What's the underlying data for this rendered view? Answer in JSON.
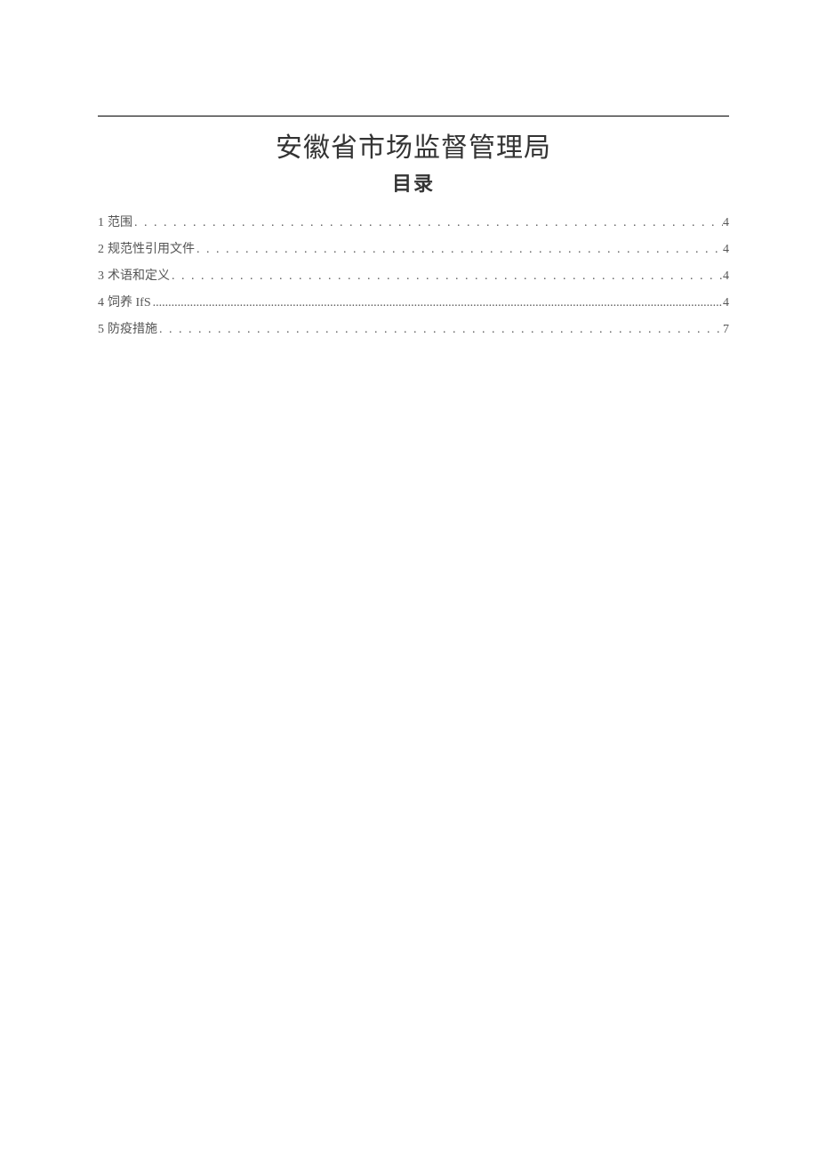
{
  "header": {
    "title": "安徽省市场监督管理局",
    "subtitle": "目录"
  },
  "toc": {
    "entries": [
      {
        "num": "1",
        "text": "范围",
        "page": "4",
        "dense": false
      },
      {
        "num": "2",
        "text": "规范性引用文件",
        "page": "4",
        "dense": false
      },
      {
        "num": "3",
        "text": "术语和定义",
        "page": "4",
        "dense": false
      },
      {
        "num": "4",
        "text": "饲养 IfS",
        "page": "4",
        "dense": true
      },
      {
        "num": "5",
        "text": "防疫措施",
        "page": "7",
        "dense": false
      }
    ]
  }
}
